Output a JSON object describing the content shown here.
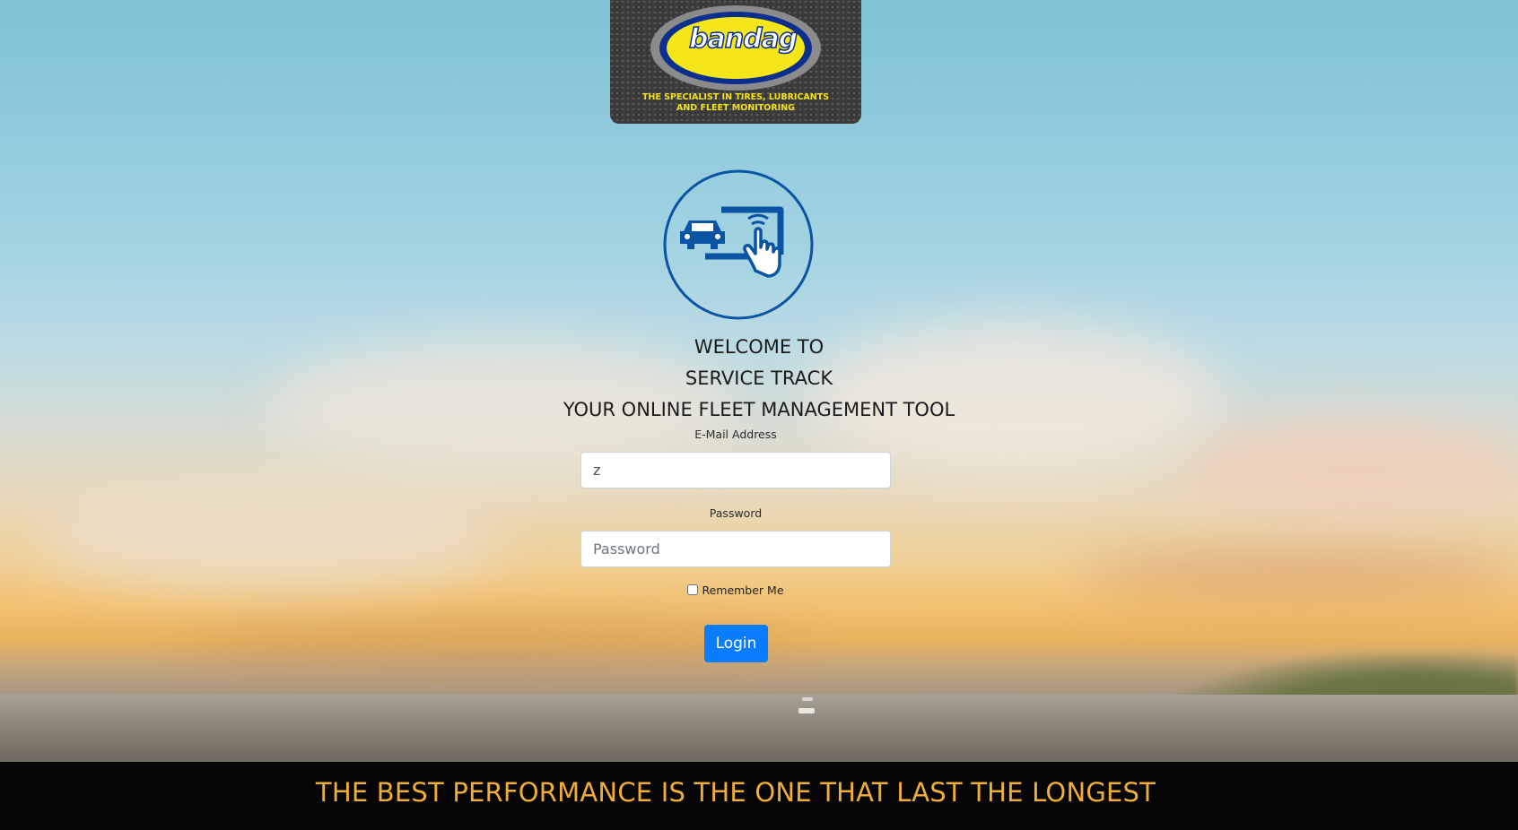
{
  "brand": {
    "logo_word": "bandag",
    "tagline_line1": "THE SPECIALIST IN TIRES, LUBRICANTS",
    "tagline_line2": "AND FLEET MONITORING",
    "icon": "fleet-touch-icon",
    "accent_color": "#0a54a3"
  },
  "welcome": {
    "line1": "WELCOME TO",
    "line2": "SERVICE TRACK",
    "line3": "YOUR ONLINE FLEET MANAGEMENT TOOL"
  },
  "form": {
    "email_label": "E-Mail Address",
    "email_value": "z",
    "password_label": "Password",
    "password_placeholder": "Password",
    "password_value": "",
    "remember_label": "Remember Me",
    "remember_checked": false,
    "login_label": "Login",
    "login_color": "#0a7cff"
  },
  "footer": {
    "slogan": "THE BEST PERFORMANCE IS THE ONE THAT LAST THE LONGEST",
    "slogan_color": "#f0ad37"
  }
}
